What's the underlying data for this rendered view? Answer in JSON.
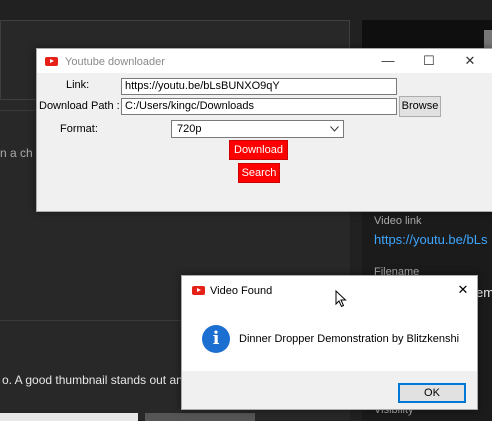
{
  "background": {
    "chip_text": "n a ch",
    "thumbnail_hint": "o. A good thumbnail stands out and",
    "video_link_label": "Video link",
    "video_link": "https://youtu.be/bLs",
    "filename_label": "Filename",
    "filename_value": "em",
    "visibility_label": "Visibility"
  },
  "downloader": {
    "title": "Youtube downloader",
    "link_label": "Link:",
    "link_value": "https://youtu.be/bLsBUNXO9qY",
    "path_label": "Download Path :",
    "path_value": "C:/Users/kingc/Downloads",
    "browse_label": "Browse",
    "format_label": "Format:",
    "format_value": "720p",
    "download_label": "Download",
    "search_label": "Search",
    "min_glyph": "—",
    "max_glyph": "☐",
    "close_glyph": "✕"
  },
  "dialog": {
    "title": "Video Found",
    "message": "Dinner Dropper Demonstration by Blitzkenshi",
    "ok_label": "OK",
    "close_glyph": "✕",
    "info_glyph": "i"
  },
  "colors": {
    "accent_red": "#ff0000",
    "info_blue": "#1a6fd1",
    "focus_blue": "#0078d7",
    "link_blue": "#3ea6ff"
  }
}
